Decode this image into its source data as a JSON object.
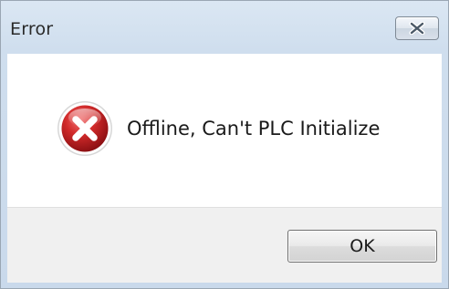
{
  "window": {
    "title": "Error"
  },
  "dialog": {
    "message": "Offline, Can't PLC Initialize",
    "icon": "error-x-icon",
    "ok_label": "OK"
  },
  "colors": {
    "icon_red": "#c8262a",
    "content_bg": "#ffffff",
    "footer_bg": "#f0f0f0",
    "title_bg": "#d5e3f1"
  }
}
